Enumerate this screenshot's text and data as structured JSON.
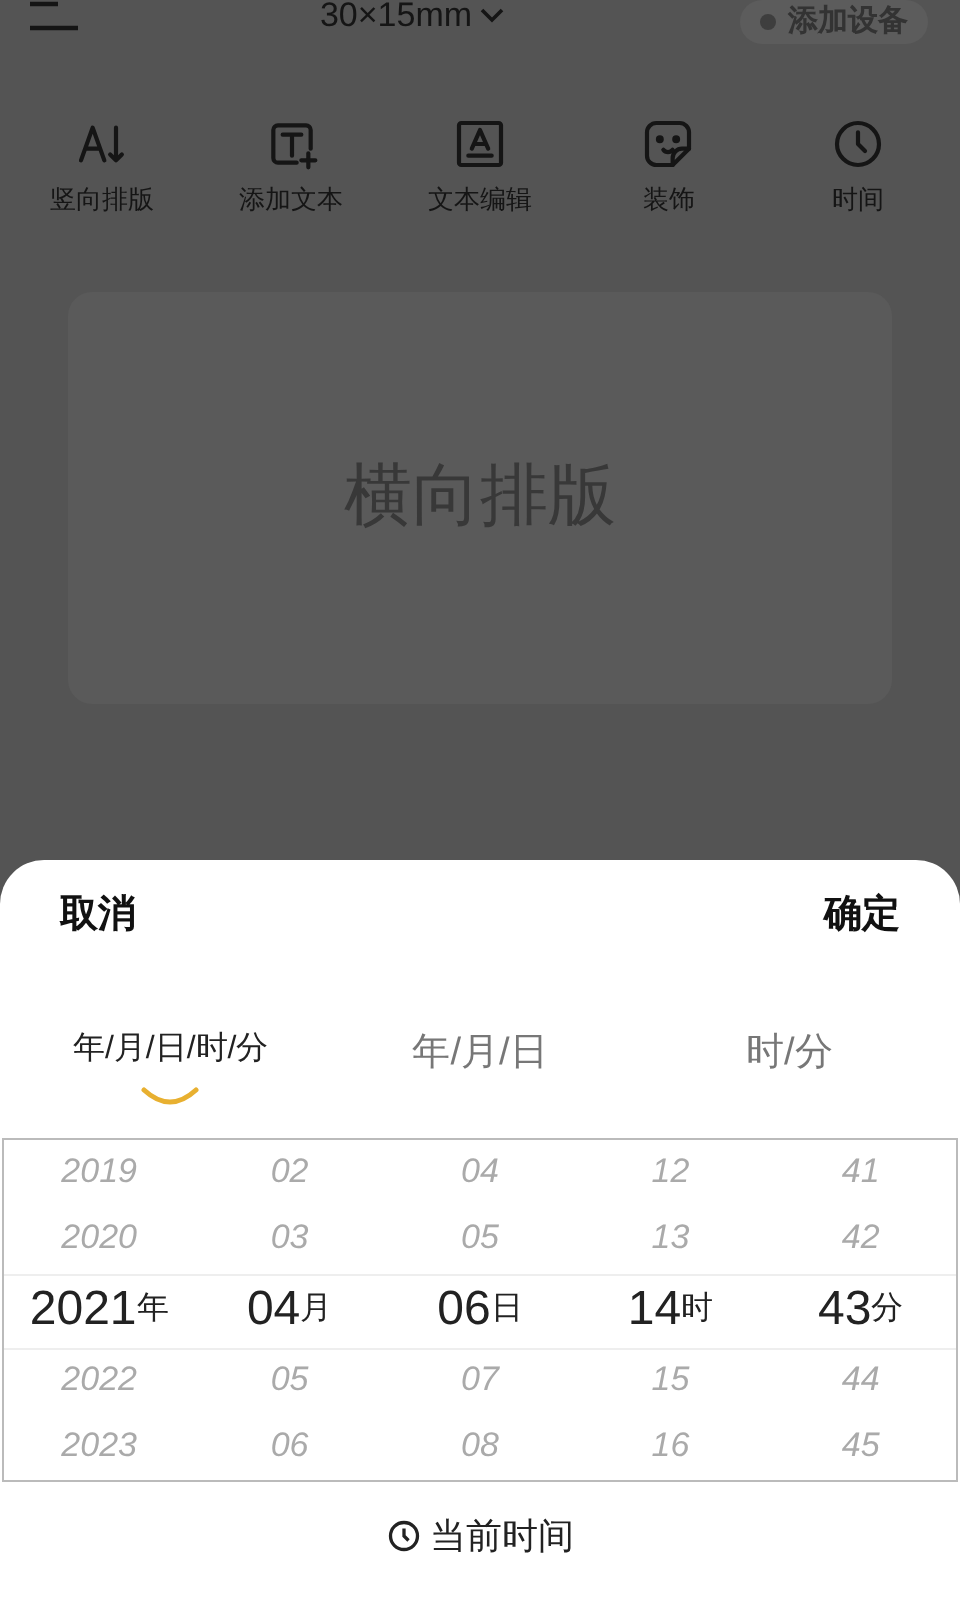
{
  "header": {
    "size": "30×15mm",
    "device_button": "添加设备"
  },
  "toolbar": [
    {
      "kind": "vertical",
      "label": "竖向排版"
    },
    {
      "kind": "addtext",
      "label": "添加文本"
    },
    {
      "kind": "edittext",
      "label": "文本编辑"
    },
    {
      "kind": "sticker",
      "label": "装饰"
    },
    {
      "kind": "clock",
      "label": "时间"
    }
  ],
  "canvas": {
    "text": "横向排版"
  },
  "sheet": {
    "cancel": "取消",
    "confirm": "确定",
    "tabs": [
      {
        "label": "年/月/日/时/分",
        "selected": true
      },
      {
        "label": "年/月/日",
        "selected": false
      },
      {
        "label": "时/分",
        "selected": false
      }
    ],
    "columns": [
      {
        "items": [
          {
            "value": "2019",
            "selected": false
          },
          {
            "value": "2020",
            "selected": false
          },
          {
            "value": "2021",
            "unit": "年",
            "selected": true
          },
          {
            "value": "2022",
            "selected": false
          },
          {
            "value": "2023",
            "selected": false
          }
        ]
      },
      {
        "items": [
          {
            "value": "02",
            "selected": false
          },
          {
            "value": "03",
            "selected": false
          },
          {
            "value": "04",
            "unit": "月",
            "selected": true
          },
          {
            "value": "05",
            "selected": false
          },
          {
            "value": "06",
            "selected": false
          }
        ]
      },
      {
        "items": [
          {
            "value": "04",
            "selected": false
          },
          {
            "value": "05",
            "selected": false
          },
          {
            "value": "06",
            "unit": "日",
            "selected": true
          },
          {
            "value": "07",
            "selected": false
          },
          {
            "value": "08",
            "selected": false
          }
        ]
      },
      {
        "items": [
          {
            "value": "12",
            "selected": false
          },
          {
            "value": "13",
            "selected": false
          },
          {
            "value": "14",
            "unit": "时",
            "selected": true
          },
          {
            "value": "15",
            "selected": false
          },
          {
            "value": "16",
            "selected": false
          }
        ]
      },
      {
        "items": [
          {
            "value": "41",
            "selected": false
          },
          {
            "value": "42",
            "selected": false
          },
          {
            "value": "43",
            "unit": "分",
            "selected": true
          },
          {
            "value": "44",
            "selected": false
          },
          {
            "value": "45",
            "selected": false
          }
        ]
      }
    ],
    "now_button": "当前时间"
  }
}
